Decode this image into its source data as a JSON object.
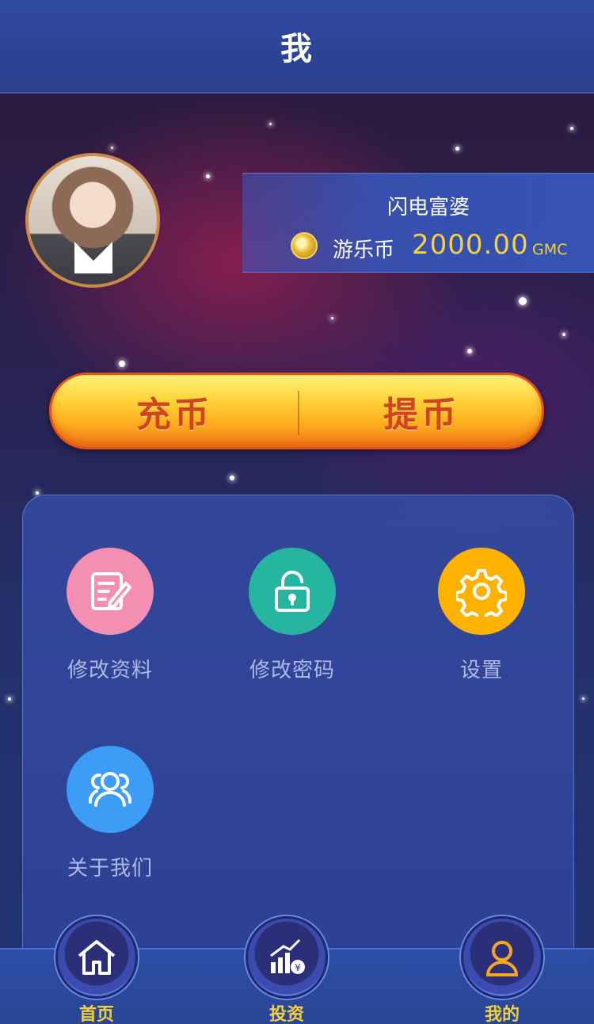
{
  "header": {
    "title": "我"
  },
  "user": {
    "name": "闪电富婆",
    "coin_label": "游乐币",
    "coin_value": "2000.00",
    "coin_unit": "GMC"
  },
  "actions": {
    "recharge": "充币",
    "withdraw": "提币"
  },
  "menu": [
    {
      "label": "修改资料",
      "icon": "edit-document-icon",
      "color": "#f48fb1"
    },
    {
      "label": "修改密码",
      "icon": "lock-icon",
      "color": "#26b5a0"
    },
    {
      "label": "设置",
      "icon": "gear-icon",
      "color": "#ffb300"
    },
    {
      "label": "关于我们",
      "icon": "users-icon",
      "color": "#3d9cf5"
    }
  ],
  "nav": [
    {
      "label": "首页",
      "icon": "home-icon"
    },
    {
      "label": "投资",
      "icon": "investment-chart-icon"
    },
    {
      "label": "我的",
      "icon": "user-icon",
      "active": true
    }
  ],
  "colors": {
    "accent": "#f5d23a",
    "header": "#2f4aa0",
    "action_text": "#d2451c"
  }
}
